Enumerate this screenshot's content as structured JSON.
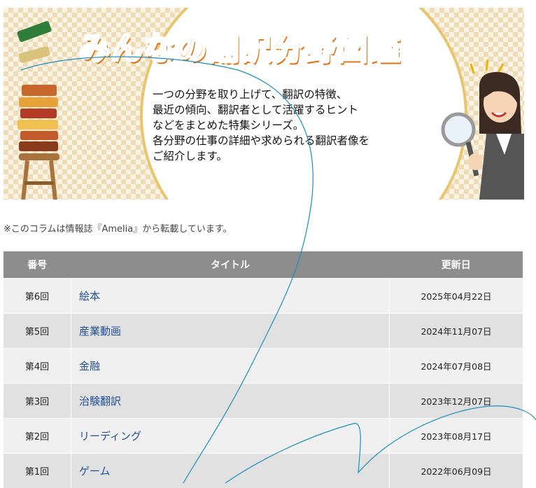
{
  "banner": {
    "title": "みんなの翻訳分野図鑑",
    "description": [
      "一つの分野を取り上げて、翻訳の特徴、",
      "最近の傾向、翻訳者として活躍するヒント",
      "などをまとめた特集シリーズ。",
      "各分野の仕事の詳細や求められる翻訳者像を",
      "ご紹介します。"
    ]
  },
  "note": "※このコラムは情報誌『Amelia』から転載しています。",
  "table": {
    "headers": {
      "number": "番号",
      "title": "タイトル",
      "updated": "更新日"
    },
    "rows": [
      {
        "number": "第6回",
        "title": "絵本",
        "date": "2025年04月22日"
      },
      {
        "number": "第5回",
        "title": "産業動画",
        "date": "2024年11月07日"
      },
      {
        "number": "第4回",
        "title": "金融",
        "date": "2024年07月08日"
      },
      {
        "number": "第3回",
        "title": "治験翻訳",
        "date": "2023年12月07日"
      },
      {
        "number": "第2回",
        "title": "リーディング",
        "date": "2023年08月17日"
      },
      {
        "number": "第1回",
        "title": "ゲーム",
        "date": "2022年06月09日"
      }
    ]
  },
  "colors": {
    "title_orange": "#f07a14",
    "header_gray": "#8d8d8d",
    "link_blue": "#1f4e9e",
    "scribble": "#1a8fc0"
  }
}
